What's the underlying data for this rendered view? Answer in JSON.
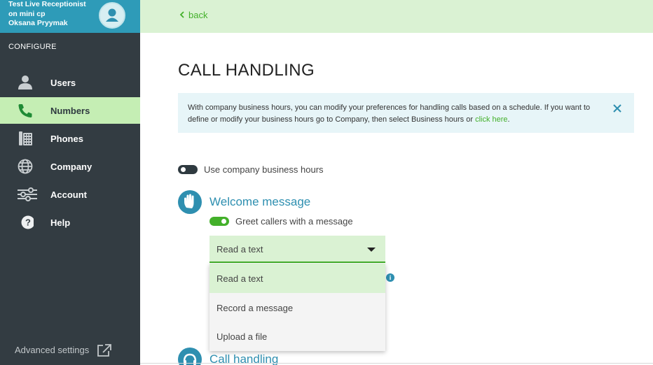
{
  "sidebar": {
    "header_line1": "Test Live Receptionist",
    "header_line2": "on mini cp",
    "header_line3": "Oksana Pryymak",
    "section_label": "CONFIGURE",
    "items": [
      {
        "label": "Users",
        "icon": "user-icon"
      },
      {
        "label": "Numbers",
        "icon": "phone-icon",
        "active": true
      },
      {
        "label": "Phones",
        "icon": "desk-phone-icon"
      },
      {
        "label": "Company",
        "icon": "globe-icon"
      },
      {
        "label": "Account",
        "icon": "sliders-icon"
      },
      {
        "label": "Help",
        "icon": "help-icon"
      }
    ],
    "advanced_settings": "Advanced settings"
  },
  "topbar": {
    "back_label": "back"
  },
  "page": {
    "title": "CALL HANDLING",
    "info_text": "With company business hours, you can modify your preferences for handling calls based on a schedule. If you want to define or modify your business hours go to Company, then select Business hours or ",
    "info_link": "click here",
    "info_end": "."
  },
  "business_hours_toggle": {
    "label": "Use company business hours",
    "on": false
  },
  "welcome": {
    "title": "Welcome message",
    "toggle_label": "Greet callers with a message",
    "toggle_on": true,
    "select_value": "Read a text",
    "options": [
      "Read a text",
      "Record a message",
      "Upload a file"
    ]
  },
  "call_handling_section": {
    "title": "Call handling"
  },
  "colors": {
    "accent": "#2e8fb0",
    "green": "#43b02a",
    "sidebar": "#333c42",
    "light_green": "#daf2d3"
  }
}
